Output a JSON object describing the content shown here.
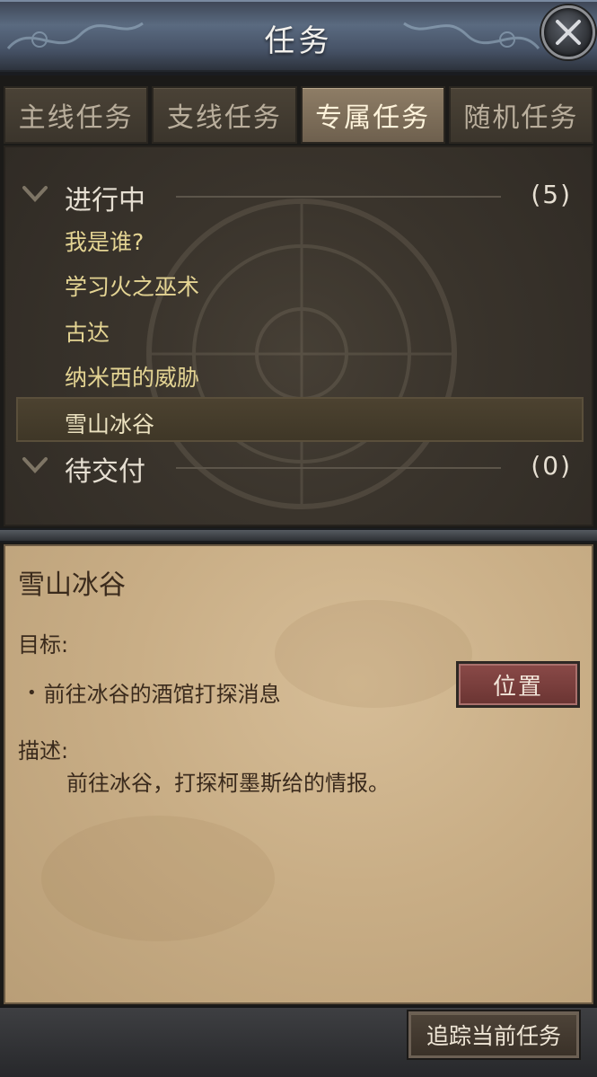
{
  "window": {
    "title": "任务",
    "close_icon": "close-icon"
  },
  "tabs": [
    {
      "label": "主线任务",
      "active": false
    },
    {
      "label": "支线任务",
      "active": false
    },
    {
      "label": "专属任务",
      "active": true
    },
    {
      "label": "随机任务",
      "active": false
    }
  ],
  "sections": {
    "in_progress": {
      "label": "进行中",
      "count": "(5)",
      "quests": [
        "我是谁?",
        "学习火之巫术",
        "古达",
        "纳米西的威胁",
        "雪山冰谷"
      ],
      "selected": "雪山冰谷"
    },
    "pending_delivery": {
      "label": "待交付",
      "count": "(0)"
    }
  },
  "detail": {
    "title": "雪山冰谷",
    "goal_label": "目标:",
    "goal_item": "前往冰谷的酒馆打探消息",
    "location_button": "位置",
    "desc_label": "描述:",
    "description": "前往冰谷，打探柯墨斯给的情报。"
  },
  "footer": {
    "track_button": "追踪当前任务"
  },
  "colors": {
    "quest_text": "#e4d493",
    "active_tab": "#7d6d58",
    "location_button": "#7a403e"
  }
}
